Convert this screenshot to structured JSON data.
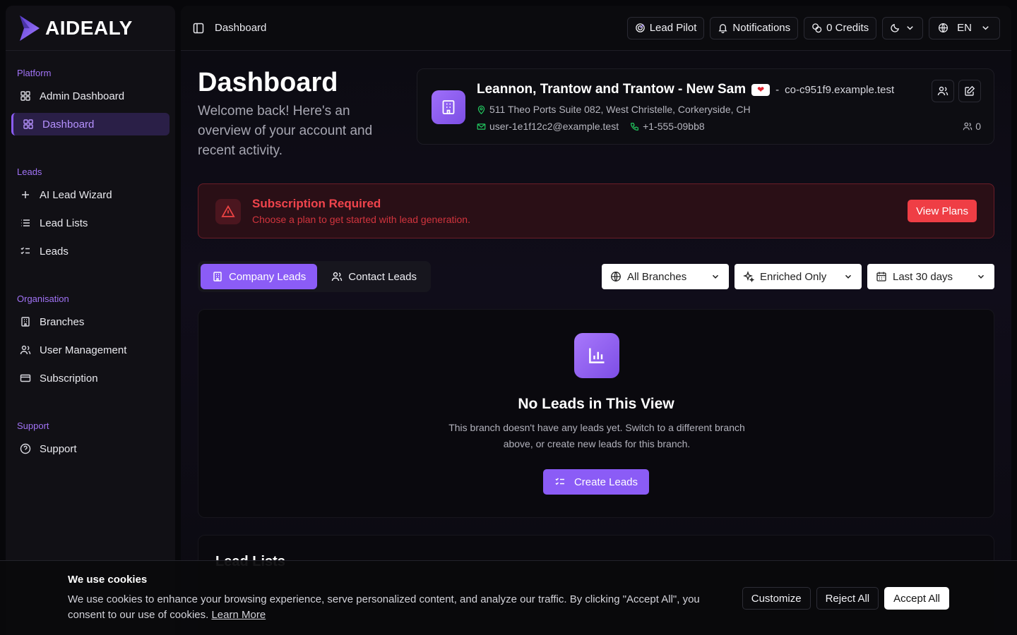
{
  "brand": {
    "name": "AIDEALY",
    "accent": "#8b5cf6"
  },
  "sidebar": {
    "groups": [
      {
        "label": "Platform",
        "items": [
          {
            "label": "Admin Dashboard",
            "icon": "grid-icon"
          },
          {
            "label": "Dashboard",
            "icon": "grid-icon",
            "active": true
          }
        ]
      },
      {
        "label": "Leads",
        "items": [
          {
            "label": "AI Lead Wizard",
            "icon": "plus-icon"
          },
          {
            "label": "Lead Lists",
            "icon": "list-icon"
          },
          {
            "label": "Leads",
            "icon": "checklist-icon"
          }
        ]
      },
      {
        "label": "Organisation",
        "items": [
          {
            "label": "Branches",
            "icon": "building-icon"
          },
          {
            "label": "User Management",
            "icon": "users-icon"
          },
          {
            "label": "Subscription",
            "icon": "credit-card-icon"
          }
        ]
      },
      {
        "label": "Support",
        "items": [
          {
            "label": "Support",
            "icon": "help-circle-icon"
          }
        ]
      }
    ]
  },
  "topbar": {
    "breadcrumb": "Dashboard",
    "lead_pilot": "Lead Pilot",
    "notifications": "Notifications",
    "credits": "0 Credits",
    "language": "EN"
  },
  "header": {
    "title": "Dashboard",
    "subtitle": "Welcome back! Here's an overview of your account and recent activity."
  },
  "company": {
    "name": "Leannon, Trantow and Trantow - New Sam",
    "separator": "-",
    "domain": "co-c951f9.example.test",
    "address": "511 Theo Ports Suite 082, West Christelle, Corkeryside, CH",
    "email": "user-1e1f12c2@example.test",
    "phone": "+1-555-09bb8",
    "user_count": "0"
  },
  "alert": {
    "title": "Subscription Required",
    "text": "Choose a plan to get started with lead generation.",
    "action": "View Plans",
    "color": "#ef4444"
  },
  "tabs": [
    {
      "label": "Company Leads",
      "active": true
    },
    {
      "label": "Contact Leads",
      "active": false
    }
  ],
  "filters": {
    "branch": "All Branches",
    "enrichment": "Enriched Only",
    "range": "Last 30 days"
  },
  "empty_state": {
    "title": "No Leads in This View",
    "text": "This branch doesn't have any leads yet. Switch to a different branch above, or create new leads for this branch.",
    "action": "Create Leads"
  },
  "lead_lists": {
    "title": "Lead Lists"
  },
  "cookie": {
    "title": "We use cookies",
    "text": "We use cookies to enhance your browsing experience, serve personalized content, and analyze our traffic. By clicking \"Accept All\", you consent to our use of cookies.",
    "learn_more": "Learn More",
    "customize": "Customize",
    "reject": "Reject All",
    "accept": "Accept All"
  }
}
